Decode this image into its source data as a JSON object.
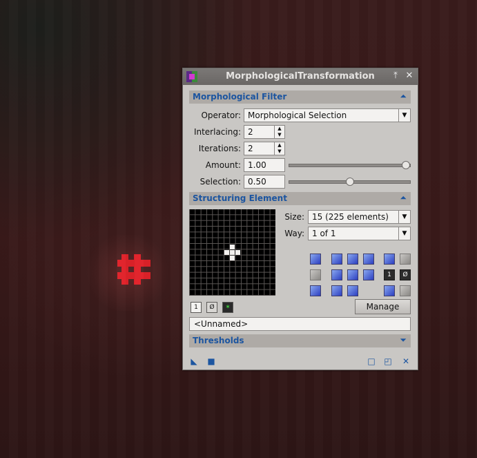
{
  "window": {
    "title": "MorphologicalTransformation"
  },
  "morph_filter": {
    "section_label": "Morphological Filter",
    "operator_label": "Operator:",
    "operator_value": "Morphological Selection",
    "interlacing_label": "Interlacing:",
    "interlacing_value": "2",
    "iterations_label": "Iterations:",
    "iterations_value": "2",
    "amount_label": "Amount:",
    "amount_value": "1.00",
    "amount_fraction": 1.0,
    "selection_label": "Selection:",
    "selection_value": "0.50",
    "selection_fraction": 0.5
  },
  "structuring": {
    "section_label": "Structuring Element",
    "size_label": "Size:",
    "size_value": "15  (225 elements)",
    "way_label": "Way:",
    "way_value": "1 of 1",
    "manage_label": "Manage",
    "name_value": "<Unnamed>",
    "grid_size": 15,
    "active_cells": [
      [
        6,
        7
      ],
      [
        7,
        6
      ],
      [
        7,
        7
      ],
      [
        7,
        8
      ],
      [
        8,
        7
      ]
    ]
  },
  "thresholds": {
    "section_label": "Thresholds"
  },
  "colors": {
    "accent": "#1c55a0",
    "star": "#e1222a"
  }
}
